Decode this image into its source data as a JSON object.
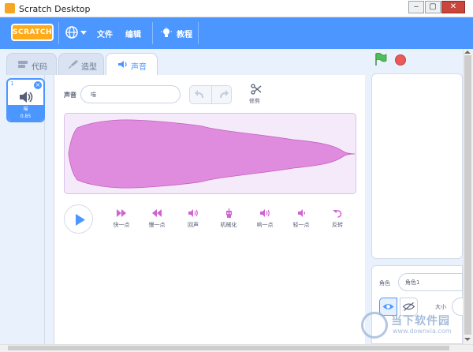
{
  "window": {
    "title": "Scratch Desktop",
    "minimize_glyph": "‒",
    "maximize_glyph": "▢",
    "close_glyph": "✕"
  },
  "menubar": {
    "logo_text": "SCRATCH",
    "language_icon": "globe-icon",
    "items": {
      "file": "文件",
      "edit": "编辑",
      "tutorials": "教程"
    },
    "color": "#4c97ff"
  },
  "tabs": {
    "code": "代码",
    "costumes": "造型",
    "sounds": "声音"
  },
  "sound_list": {
    "items": [
      {
        "number": "1",
        "name": "喵",
        "duration": "0.85",
        "delete_glyph": "×"
      }
    ]
  },
  "editor": {
    "sound_label": "声音",
    "sound_name": "喵",
    "trim_label": "修剪",
    "waveform_color": "#e08cde"
  },
  "effects": [
    {
      "key": "faster",
      "label": "快一点",
      "icon": "faster-icon"
    },
    {
      "key": "slower",
      "label": "慢一点",
      "icon": "slower-icon"
    },
    {
      "key": "echo",
      "label": "回声",
      "icon": "echo-icon"
    },
    {
      "key": "robot",
      "label": "机械化",
      "icon": "robot-icon"
    },
    {
      "key": "louder",
      "label": "响一点",
      "icon": "louder-icon"
    },
    {
      "key": "softer",
      "label": "轻一点",
      "icon": "softer-icon"
    },
    {
      "key": "reverse",
      "label": "反转",
      "icon": "reverse-icon"
    }
  ],
  "sprite_panel": {
    "sprite_label": "角色",
    "sprite_name": "角色1",
    "size_label": "大小"
  },
  "watermark": {
    "text": "当下软件园",
    "sub": "www.downxia.com"
  }
}
